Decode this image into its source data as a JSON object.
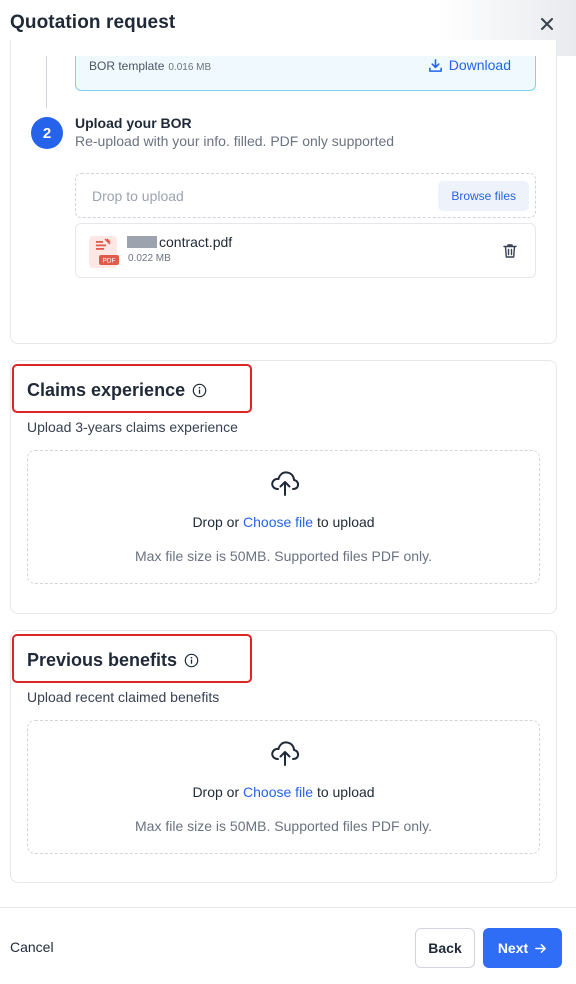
{
  "header": {
    "title": "Quotation request",
    "close_icon": "close-icon"
  },
  "template": {
    "label": "BOR template",
    "size": "0.016 MB",
    "download_label": "Download"
  },
  "step2": {
    "number": "2",
    "title": "Upload your BOR",
    "subtitle": "Re-upload with your info. filled. PDF only supported",
    "drop_placeholder": "Drop to upload",
    "browse_label": "Browse files",
    "file": {
      "name": "contract.pdf",
      "size": "0.022 MB",
      "icon": "pdf-file-icon",
      "icon_badge": "PDF"
    }
  },
  "claims": {
    "title": "Claims experience",
    "subtitle": "Upload 3-years claims experience",
    "drop_prefix": "Drop or ",
    "choose_label": "Choose file",
    "drop_suffix": " to upload",
    "note": "Max file size is 50MB. Supported files PDF only."
  },
  "benefits": {
    "title": "Previous benefits",
    "subtitle": "Upload recent claimed benefits",
    "drop_prefix": "Drop or ",
    "choose_label": "Choose file",
    "drop_suffix": " to upload",
    "note": "Max file size is 50MB. Supported files PDF only."
  },
  "footer": {
    "cancel_label": "Cancel",
    "back_label": "Back",
    "next_label": "Next"
  },
  "colors": {
    "accent": "#2563eb",
    "highlight": "#dc2626"
  }
}
